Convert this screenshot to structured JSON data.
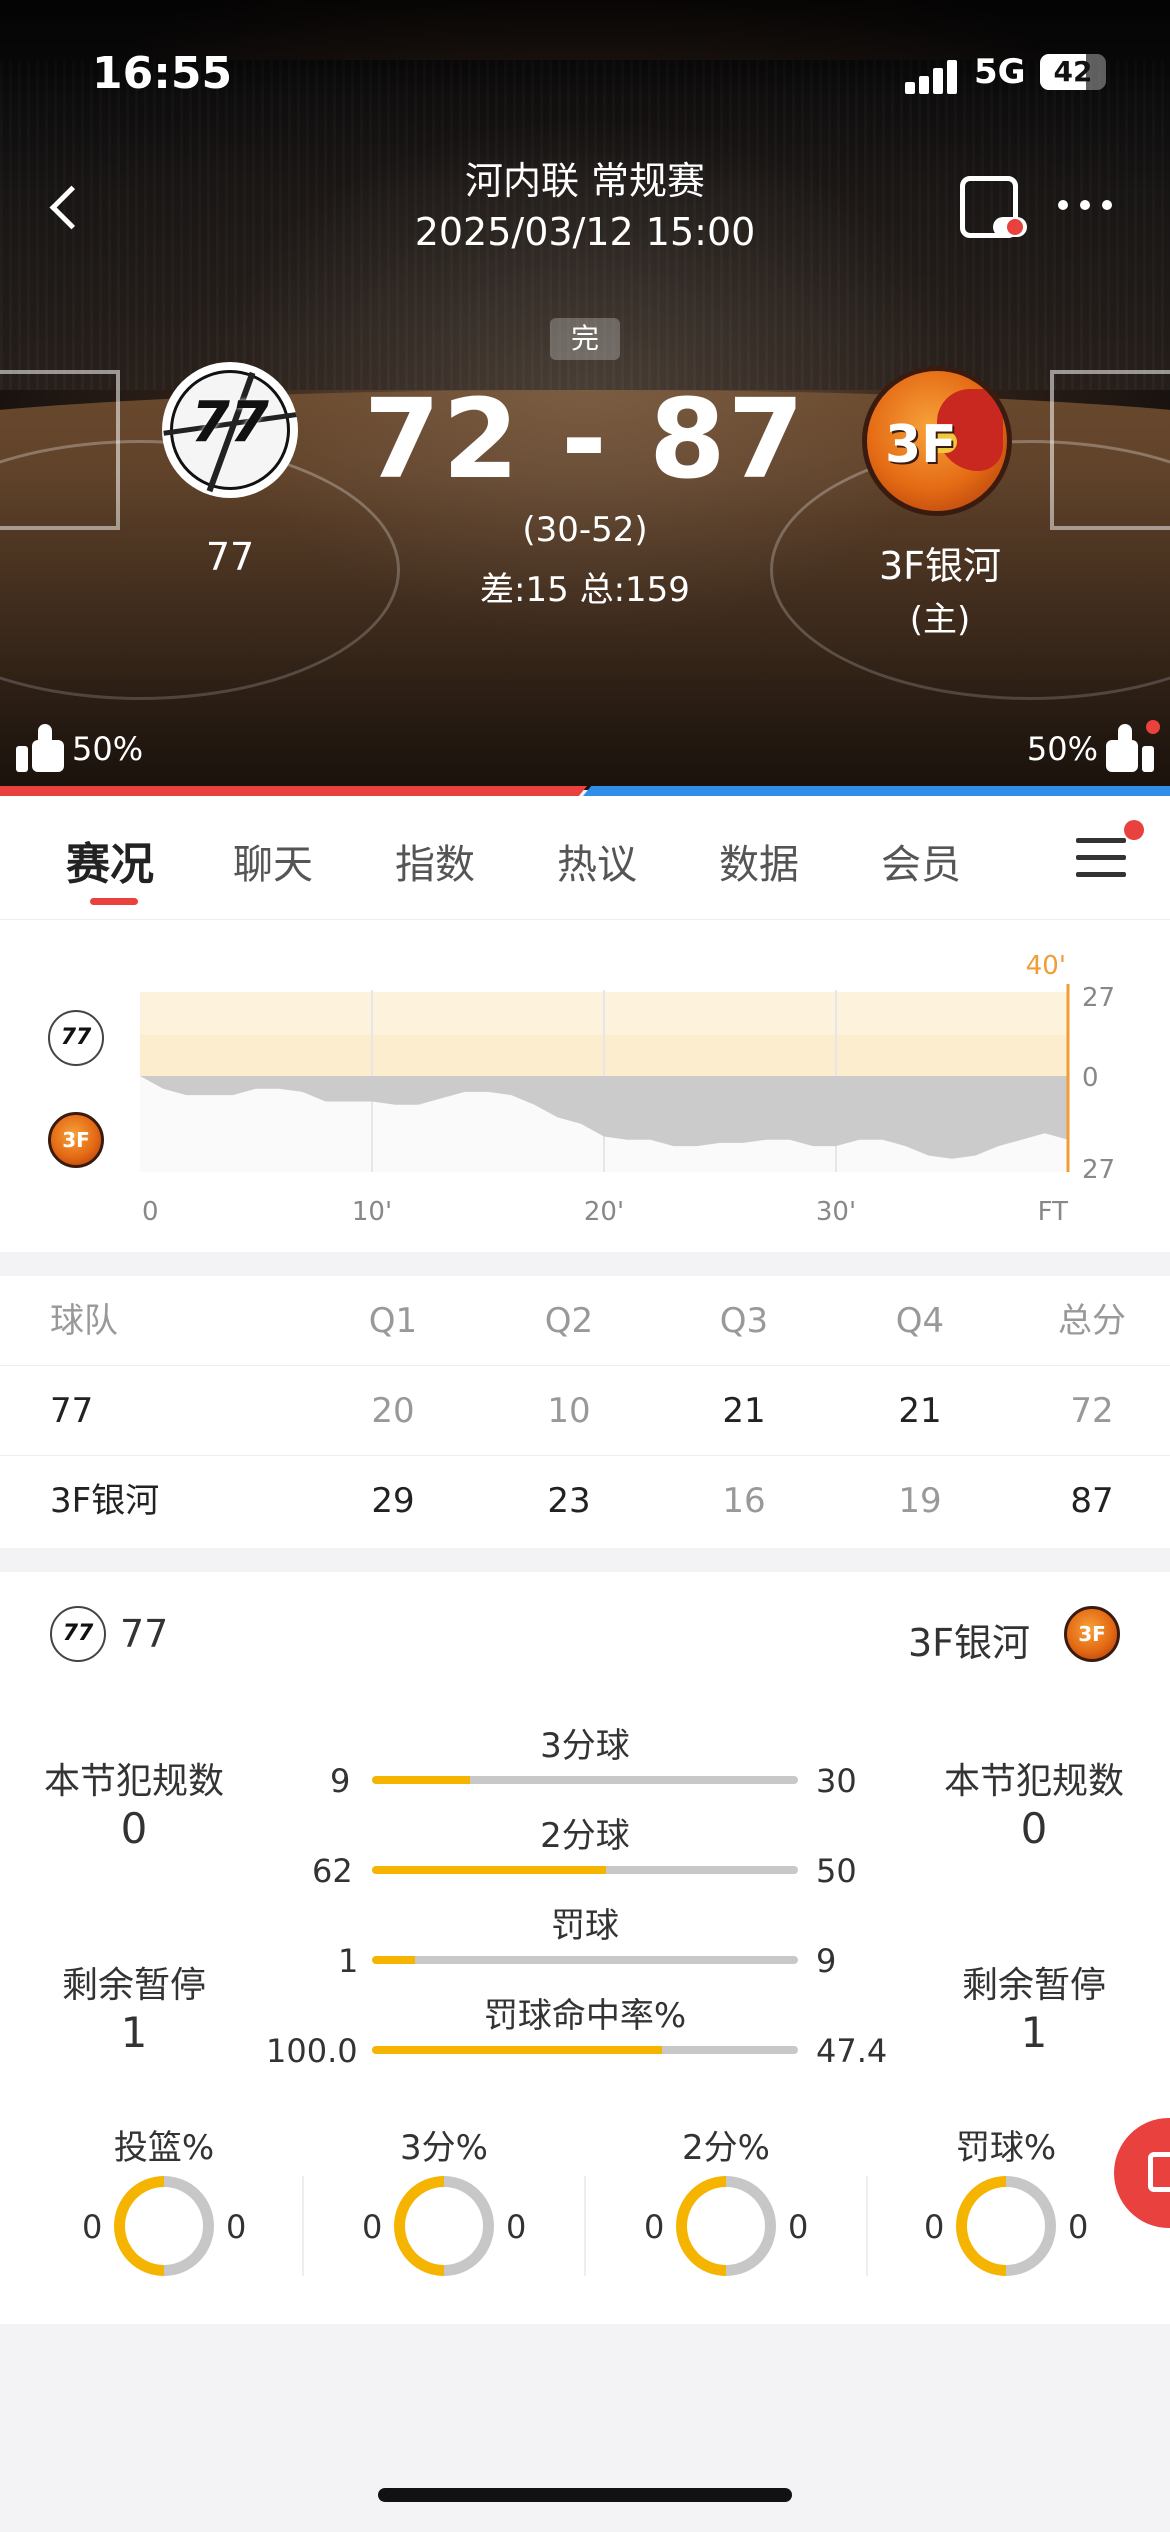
{
  "status_bar": {
    "time": "16:55",
    "network": "5G",
    "battery": "42"
  },
  "header": {
    "league": "河内联 常规赛",
    "datetime": "2025/03/12 15:00"
  },
  "match": {
    "status": "完",
    "score": "72 - 87",
    "half_score": "(30-52)",
    "diff_total": "差:15 总:159",
    "home_team": {
      "name": "77",
      "logo_text": "77"
    },
    "away_team": {
      "name": "3F银河",
      "logo_text": "3F",
      "home_mark": "(主)"
    }
  },
  "votes": {
    "left": "50%",
    "right": "50%",
    "left_share": 50,
    "right_share": 50
  },
  "tabs": [
    {
      "label": "赛况",
      "active": true
    },
    {
      "label": "聊天"
    },
    {
      "label": "指数"
    },
    {
      "label": "热议"
    },
    {
      "label": "数据"
    },
    {
      "label": "会员"
    }
  ],
  "trend": {
    "current_minute_label": "40'",
    "y_top": "27",
    "y_mid": "0",
    "y_bottom": "27",
    "x_labels": [
      "0",
      "10'",
      "20'",
      "30'",
      "FT"
    ]
  },
  "chart_data": {
    "type": "area",
    "title": "",
    "x": [
      0,
      1,
      2,
      3,
      4,
      5,
      6,
      7,
      8,
      9,
      10,
      11,
      12,
      13,
      14,
      15,
      16,
      17,
      18,
      19,
      20,
      21,
      22,
      23,
      24,
      25,
      26,
      27,
      28,
      29,
      30,
      31,
      32,
      33,
      34,
      35,
      36,
      37,
      38,
      39,
      40
    ],
    "values": [
      0,
      -4,
      -6,
      -6,
      -6,
      -4,
      -4,
      -5,
      -8,
      -8,
      -8,
      -9,
      -9,
      -7,
      -5,
      -5,
      -6,
      -9,
      -13,
      -15,
      -19,
      -20,
      -20,
      -22,
      -22,
      -21,
      -21,
      -20,
      -20,
      -22,
      -22,
      -20,
      -20,
      -22,
      -25,
      -26,
      -25,
      -22,
      -20,
      -18,
      -20
    ],
    "ylim": [
      -27,
      27
    ],
    "xlabel": "",
    "ylabel": ""
  },
  "quarters": {
    "headers": [
      "球队",
      "Q1",
      "Q2",
      "Q3",
      "Q4",
      "总分"
    ],
    "rows": [
      {
        "team": "77",
        "q1": "20",
        "q2": "10",
        "q3": "21",
        "q4": "21",
        "total": "72"
      },
      {
        "team": "3F银河",
        "q1": "29",
        "q2": "23",
        "q3": "16",
        "q4": "19",
        "total": "87"
      }
    ]
  },
  "team_stats": {
    "left_team": "77",
    "right_team": "3F银河",
    "left_fouls_label": "本节犯规数",
    "left_fouls": "0",
    "right_fouls_label": "本节犯规数",
    "right_fouls": "0",
    "left_timeouts_label": "剩余暂停",
    "left_timeouts": "1",
    "right_timeouts_label": "剩余暂停",
    "right_timeouts": "1",
    "bars": [
      {
        "title": "3分球",
        "left": "9",
        "right": "30",
        "left_share": 0.23
      },
      {
        "title": "2分球",
        "left": "62",
        "right": "50",
        "left_share": 0.55
      },
      {
        "title": "罚球",
        "left": "1",
        "right": "9",
        "left_share": 0.1
      },
      {
        "title": "罚球命中率%",
        "left": "100.0",
        "right": "47.4",
        "left_share": 0.68
      }
    ],
    "rings": [
      {
        "label": "投篮%",
        "left": "0",
        "right": "0"
      },
      {
        "label": "3分%",
        "left": "0",
        "right": "0"
      },
      {
        "label": "2分%",
        "left": "0",
        "right": "0"
      },
      {
        "label": "罚球%",
        "left": "0",
        "right": "0"
      }
    ]
  },
  "colors": {
    "accent": "#e8413e",
    "home_blue": "#2e8ee8",
    "stat_yellow": "#f4b400"
  },
  "icons": [
    "back-icon",
    "phone-live-icon",
    "more-icon",
    "thumbs-up-icon",
    "menu-icon",
    "edit-icon"
  ]
}
